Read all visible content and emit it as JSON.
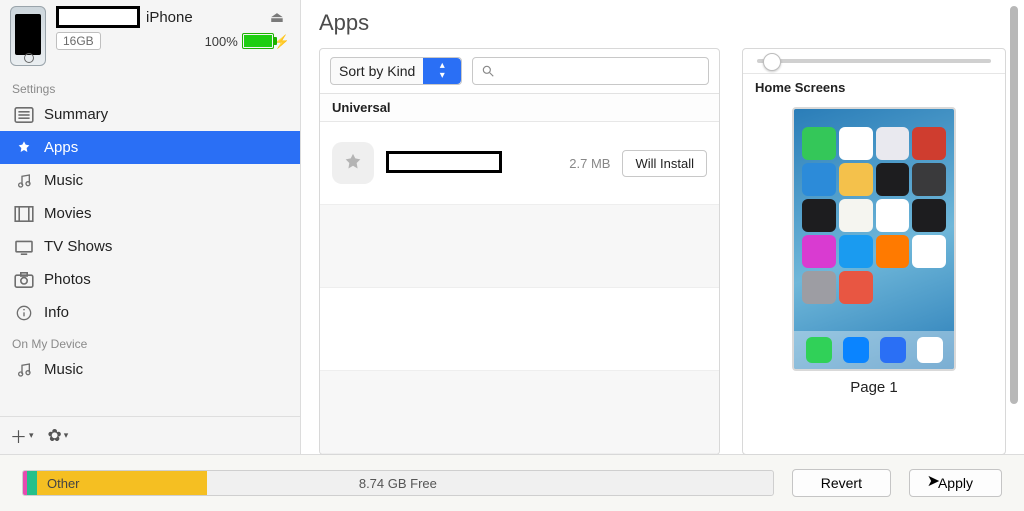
{
  "device": {
    "name_suffix": "iPhone",
    "capacity": "16GB",
    "battery_pct": "100%"
  },
  "sidebar": {
    "settings_header": "Settings",
    "items": [
      {
        "label": "Summary"
      },
      {
        "label": "Apps"
      },
      {
        "label": "Music"
      },
      {
        "label": "Movies"
      },
      {
        "label": "TV Shows"
      },
      {
        "label": "Photos"
      },
      {
        "label": "Info"
      }
    ],
    "on_device_header": "On My Device",
    "on_device": [
      {
        "label": "Music"
      }
    ]
  },
  "main": {
    "title": "Apps",
    "sort_label": "Sort by Kind",
    "search_placeholder": "",
    "group": "Universal",
    "app": {
      "size": "2.7 MB",
      "action": "Will Install"
    },
    "home_screens": "Home Screens",
    "page_label": "Page 1"
  },
  "footer": {
    "other": "Other",
    "free": "8.74 GB Free",
    "revert": "Revert",
    "apply": "Apply"
  },
  "colors": {
    "accent": "#2a6ff5",
    "other_seg": "#f5bf22",
    "seg_a": "#e74bb0",
    "seg_b": "#24c08a"
  }
}
